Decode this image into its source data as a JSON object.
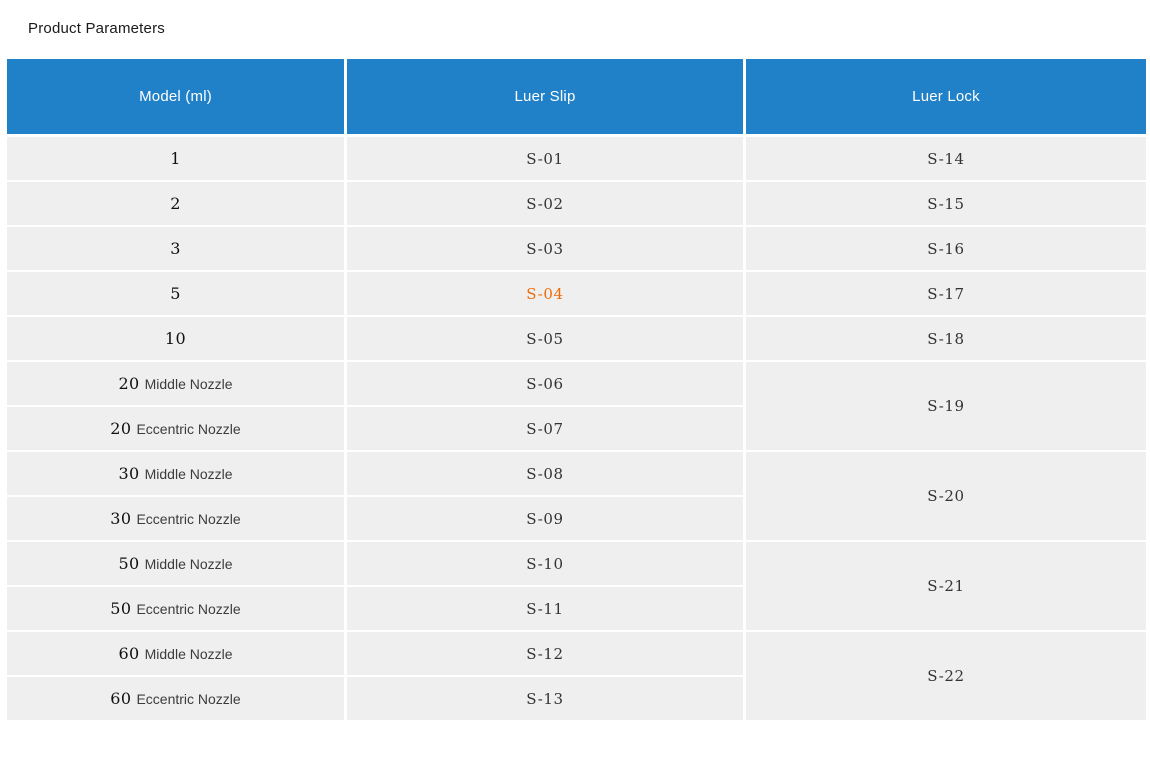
{
  "page": {
    "title": "Product Parameters"
  },
  "theme": {
    "header_bg": "#2080c8",
    "header_text": "#ffffff",
    "row_bg": "#efefef",
    "body_text": "#333333",
    "model_text": "#111111",
    "highlight_orange": "#ee6c08",
    "title_text": "#1a1a1a"
  },
  "table": {
    "columns": [
      {
        "label": "Model (ml)"
      },
      {
        "label": "Luer Slip"
      },
      {
        "label": "Luer Lock"
      }
    ],
    "rows": [
      {
        "model": "1",
        "luer_slip": "S-01",
        "luer_lock": "S-14"
      },
      {
        "model": "2",
        "luer_slip": "S-02",
        "luer_lock": "S-15"
      },
      {
        "model": "3",
        "luer_slip": "S-03",
        "luer_lock": "S-16"
      },
      {
        "model": "5",
        "luer_slip": "S-04",
        "luer_slip_highlight": true,
        "luer_lock": "S-17"
      },
      {
        "model": "10",
        "luer_slip": "S-05",
        "luer_lock": "S-18"
      },
      {
        "model": "20",
        "model_label": "Middle Nozzle",
        "luer_slip": "S-06",
        "luer_lock": "S-19",
        "luer_lock_rowspan": 2
      },
      {
        "model": "20",
        "model_label": "Eccentric Nozzle",
        "luer_slip": "S-07"
      },
      {
        "model": "30",
        "model_label": "Middle Nozzle",
        "luer_slip": "S-08",
        "luer_lock": "S-20",
        "luer_lock_rowspan": 2
      },
      {
        "model": "30",
        "model_label": "Eccentric Nozzle",
        "luer_slip": "S-09"
      },
      {
        "model": "50",
        "model_label": "Middle Nozzle",
        "luer_slip": "S-10",
        "luer_lock": "S-21",
        "luer_lock_rowspan": 2
      },
      {
        "model": "50",
        "model_label": "Eccentric Nozzle",
        "luer_slip": "S-11"
      },
      {
        "model": "60",
        "model_label": "Middle Nozzle",
        "luer_slip": "S-12",
        "luer_lock": "S-22",
        "luer_lock_rowspan": 2
      },
      {
        "model": "60",
        "model_label": "Eccentric Nozzle",
        "luer_slip": "S-13"
      }
    ]
  }
}
